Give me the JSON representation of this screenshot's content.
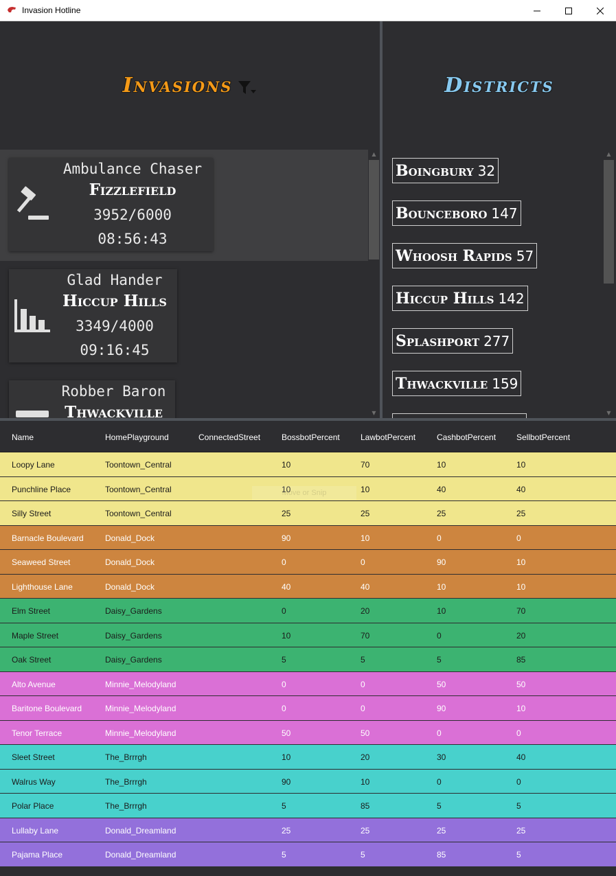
{
  "window": {
    "title": "Invasion Hotline"
  },
  "panels": {
    "invasions_title": "Invasions",
    "districts_title": "Districts"
  },
  "invasions": [
    {
      "cog": "Ambulance Chaser",
      "district": "Fizzlefield",
      "progress": "3952/6000",
      "time": "08:56:43",
      "icon": "gavel-icon",
      "selected": true
    },
    {
      "cog": "Glad Hander",
      "district": "Hiccup Hills",
      "progress": "3349/4000",
      "time": "09:16:45",
      "icon": "bar-chart-icon",
      "selected": false
    },
    {
      "cog": "Robber Baron",
      "district": "Thwackville",
      "progress": "",
      "time": "",
      "icon": "cash-register-icon",
      "selected": false
    }
  ],
  "districts": [
    {
      "name": "Boingbury",
      "count": "32"
    },
    {
      "name": "Bounceboro",
      "count": "147"
    },
    {
      "name": "Whoosh Rapids",
      "count": "57"
    },
    {
      "name": "Hiccup Hills",
      "count": "142"
    },
    {
      "name": "Splashport",
      "count": "277"
    },
    {
      "name": "Thwackville",
      "count": "159"
    }
  ],
  "grid": {
    "columns": [
      "Name",
      "HomePlayground",
      "ConnectedStreet",
      "BossbotPercent",
      "LawbotPercent",
      "CashbotPercent",
      "SellbotPercent"
    ],
    "ghost_text": "Move or Snip",
    "rows": [
      {
        "name": "Loopy Lane",
        "home": "Toontown_Central",
        "connected": "",
        "boss": "10",
        "law": "70",
        "cash": "10",
        "sell": "10",
        "color": "#f0e68c",
        "text": "dark"
      },
      {
        "name": "Punchline Place",
        "home": "Toontown_Central",
        "connected": "",
        "boss": "10",
        "law": "10",
        "cash": "40",
        "sell": "40",
        "color": "#f0e68c",
        "text": "dark"
      },
      {
        "name": "Silly Street",
        "home": "Toontown_Central",
        "connected": "",
        "boss": "25",
        "law": "25",
        "cash": "25",
        "sell": "25",
        "color": "#f0e68c",
        "text": "dark"
      },
      {
        "name": "Barnacle Boulevard",
        "home": "Donald_Dock",
        "connected": "",
        "boss": "90",
        "law": "10",
        "cash": "0",
        "sell": "0",
        "color": "#cd853f",
        "text": "light"
      },
      {
        "name": "Seaweed Street",
        "home": "Donald_Dock",
        "connected": "",
        "boss": "0",
        "law": "0",
        "cash": "90",
        "sell": "10",
        "color": "#cd853f",
        "text": "light"
      },
      {
        "name": "Lighthouse Lane",
        "home": "Donald_Dock",
        "connected": "",
        "boss": "40",
        "law": "40",
        "cash": "10",
        "sell": "10",
        "color": "#cd853f",
        "text": "light"
      },
      {
        "name": "Elm Street",
        "home": "Daisy_Gardens",
        "connected": "",
        "boss": "0",
        "law": "20",
        "cash": "10",
        "sell": "70",
        "color": "#3cb371",
        "text": "dark"
      },
      {
        "name": "Maple Street",
        "home": "Daisy_Gardens",
        "connected": "",
        "boss": "10",
        "law": "70",
        "cash": "0",
        "sell": "20",
        "color": "#3cb371",
        "text": "dark"
      },
      {
        "name": "Oak Street",
        "home": "Daisy_Gardens",
        "connected": "",
        "boss": "5",
        "law": "5",
        "cash": "5",
        "sell": "85",
        "color": "#3cb371",
        "text": "dark"
      },
      {
        "name": "Alto Avenue",
        "home": "Minnie_Melodyland",
        "connected": "",
        "boss": "0",
        "law": "0",
        "cash": "50",
        "sell": "50",
        "color": "#da70d6",
        "text": "light"
      },
      {
        "name": "Baritone Boulevard",
        "home": "Minnie_Melodyland",
        "connected": "",
        "boss": "0",
        "law": "0",
        "cash": "90",
        "sell": "10",
        "color": "#da70d6",
        "text": "light"
      },
      {
        "name": "Tenor Terrace",
        "home": "Minnie_Melodyland",
        "connected": "",
        "boss": "50",
        "law": "50",
        "cash": "0",
        "sell": "0",
        "color": "#da70d6",
        "text": "light"
      },
      {
        "name": "Sleet Street",
        "home": "The_Brrrgh",
        "connected": "",
        "boss": "10",
        "law": "20",
        "cash": "30",
        "sell": "40",
        "color": "#48d1cc",
        "text": "dark"
      },
      {
        "name": "Walrus Way",
        "home": "The_Brrrgh",
        "connected": "",
        "boss": "90",
        "law": "10",
        "cash": "0",
        "sell": "0",
        "color": "#48d1cc",
        "text": "dark"
      },
      {
        "name": "Polar Place",
        "home": "The_Brrrgh",
        "connected": "",
        "boss": "5",
        "law": "85",
        "cash": "5",
        "sell": "5",
        "color": "#48d1cc",
        "text": "dark"
      },
      {
        "name": "Lullaby Lane",
        "home": "Donald_Dreamland",
        "connected": "",
        "boss": "25",
        "law": "25",
        "cash": "25",
        "sell": "25",
        "color": "#9370db",
        "text": "light"
      },
      {
        "name": "Pajama Place",
        "home": "Donald_Dreamland",
        "connected": "",
        "boss": "5",
        "law": "5",
        "cash": "85",
        "sell": "5",
        "color": "#9370db",
        "text": "light"
      }
    ]
  }
}
